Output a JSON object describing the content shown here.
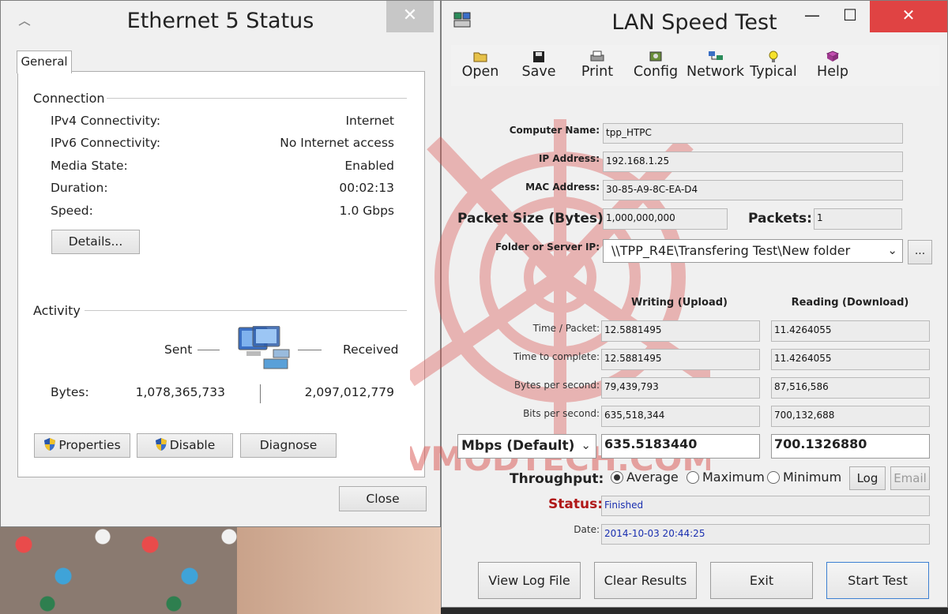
{
  "ethernet": {
    "title": "Ethernet 5 Status",
    "close_glyph": "✕",
    "tab": "General",
    "connection": {
      "heading": "Connection",
      "rows": [
        {
          "label": "IPv4 Connectivity:",
          "value": "Internet"
        },
        {
          "label": "IPv6 Connectivity:",
          "value": "No Internet access"
        },
        {
          "label": "Media State:",
          "value": "Enabled"
        },
        {
          "label": "Duration:",
          "value": "00:02:13"
        },
        {
          "label": "Speed:",
          "value": "1.0 Gbps"
        }
      ],
      "details_button": "Details..."
    },
    "activity": {
      "heading": "Activity",
      "sent_label": "Sent",
      "received_label": "Received",
      "bytes_label": "Bytes:",
      "bytes_sent": "1,078,365,733",
      "bytes_received": "2,097,012,779"
    },
    "buttons": {
      "properties": "Properties",
      "disable": "Disable",
      "diagnose": "Diagnose",
      "close": "Close"
    }
  },
  "lan": {
    "title": "LAN Speed Test",
    "window_buttons": {
      "minimize": "—",
      "maximize": "☐",
      "close": "✕"
    },
    "toolbar": [
      {
        "label": "Open",
        "icon": "open-folder-icon"
      },
      {
        "label": "Save",
        "icon": "floppy-icon"
      },
      {
        "label": "Print",
        "icon": "printer-icon"
      },
      {
        "label": "Config",
        "icon": "config-icon"
      },
      {
        "label": "Network",
        "icon": "network-icon"
      },
      {
        "label": "Typical",
        "icon": "lightbulb-icon"
      },
      {
        "label": "Help",
        "icon": "help-book-icon"
      }
    ],
    "computer_name_label": "Computer Name:",
    "computer_name": "tpp_HTPC",
    "ip_label": "IP Address:",
    "ip": "192.168.1.25",
    "mac_label": "MAC Address:",
    "mac": "30-85-A9-8C-EA-D4",
    "packet_size_label": "Packet Size (Bytes):",
    "packet_size": "1,000,000,000",
    "packets_label": "Packets:",
    "packets": "1",
    "folder_label": "Folder or Server IP:",
    "folder": "\\\\TPP_R4E\\Transfering Test\\New folder",
    "browse": "...",
    "writing_header": "Writing (Upload)",
    "reading_header": "Reading (Download)",
    "metrics": [
      {
        "label": "Time / Packet:",
        "write": "12.5881495",
        "read": "11.4264055"
      },
      {
        "label": "Time to complete:",
        "write": "12.5881495",
        "read": "11.4264055"
      },
      {
        "label": "Bytes per second:",
        "write": "79,439,793",
        "read": "87,516,586"
      },
      {
        "label": "Bits per second:",
        "write": "635,518,344",
        "read": "700,132,688"
      }
    ],
    "unit_select": "Mbps (Default)",
    "mbps_write": "635.5183440",
    "mbps_read": "700.1326880",
    "throughput_label": "Throughput:",
    "radio": {
      "average": "Average",
      "maximum": "Maximum",
      "minimum": "Minimum"
    },
    "log_button": "Log",
    "email_button": "Email",
    "status_label": "Status:",
    "status": "Finished",
    "date_label": "Date:",
    "date": "2014-10-03 20:44:25",
    "buttons": {
      "view_log": "View Log File",
      "clear": "Clear Results",
      "exit": "Exit",
      "start": "Start Test"
    },
    "watermark_text": "VMODTECH.COM",
    "colors": {
      "status_label": "#b01818",
      "status_text": "#1a2fb0",
      "close_red": "#e04343"
    }
  }
}
